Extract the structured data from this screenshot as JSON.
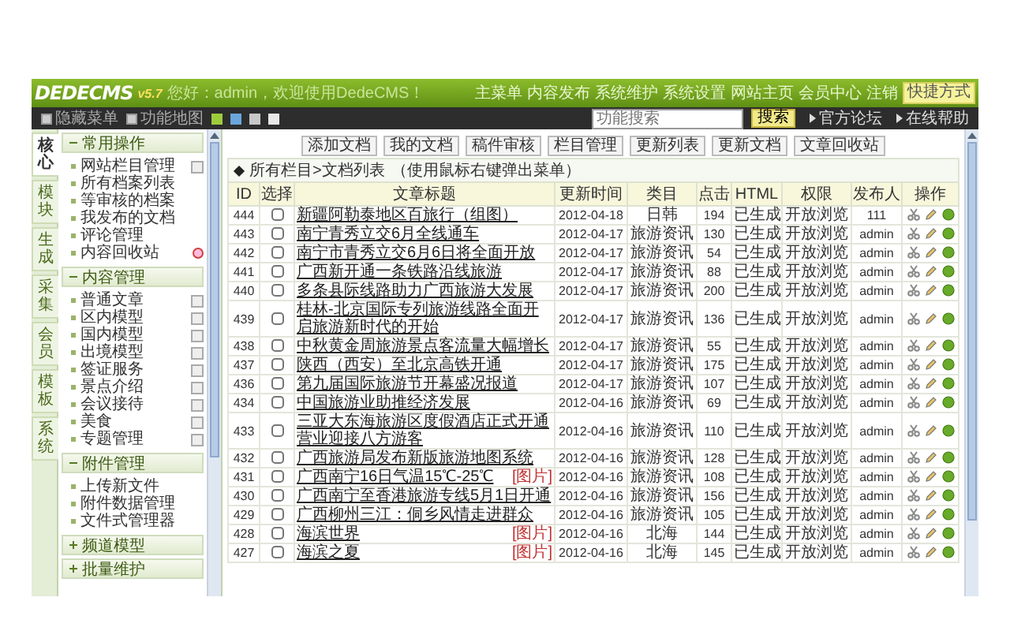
{
  "header": {
    "logo": "DEDECMS",
    "version": "v5.7",
    "welcome": "您好：admin，欢迎使用DedeCMS！",
    "nav": [
      "主菜单",
      "内容发布",
      "系统维护",
      "系统设置",
      "网站主页",
      "会员中心",
      "注销"
    ],
    "shortcut": "快捷方式"
  },
  "toolbar": {
    "buttons": [
      "隐藏菜单",
      "功能地图"
    ],
    "swatches": [
      {
        "color": "#9ccc3c"
      },
      {
        "color": "#6aa6dc"
      },
      {
        "color": "#c8c8c8"
      },
      {
        "color": "#e8e8e8"
      }
    ],
    "search": {
      "placeholder": "功能搜索",
      "button": "搜索"
    },
    "links": [
      "官方论坛",
      "在线帮助"
    ]
  },
  "side_tabs": [
    {
      "label": "核心",
      "selected": true
    },
    {
      "label": "模块",
      "selected": false
    },
    {
      "label": "生成",
      "selected": false
    },
    {
      "label": "采集",
      "selected": false
    },
    {
      "label": "会员",
      "selected": false
    },
    {
      "label": "模板",
      "selected": false
    },
    {
      "label": "系统",
      "selected": false
    }
  ],
  "menu": [
    {
      "title": "常用操作",
      "expanded": true,
      "items": [
        {
          "label": "网站栏目管理",
          "kind": "add"
        },
        {
          "label": "所有档案列表",
          "kind": "plain"
        },
        {
          "label": "等审核的档案",
          "kind": "plain"
        },
        {
          "label": "我发布的文档",
          "kind": "plain"
        },
        {
          "label": "评论管理",
          "kind": "plain"
        },
        {
          "label": "内容回收站",
          "kind": "recycle"
        }
      ]
    },
    {
      "title": "内容管理",
      "expanded": true,
      "items": [
        {
          "label": "普通文章",
          "kind": "add"
        },
        {
          "label": "区内模型",
          "kind": "add"
        },
        {
          "label": "国内模型",
          "kind": "add"
        },
        {
          "label": "出境模型",
          "kind": "add"
        },
        {
          "label": "签证服务",
          "kind": "add"
        },
        {
          "label": "景点介绍",
          "kind": "add"
        },
        {
          "label": "会议接待",
          "kind": "add"
        },
        {
          "label": "美食",
          "kind": "add"
        },
        {
          "label": "专题管理",
          "kind": "add"
        }
      ]
    },
    {
      "title": "附件管理",
      "expanded": true,
      "items": [
        {
          "label": "上传新文件",
          "kind": "plain"
        },
        {
          "label": "附件数据管理",
          "kind": "plain"
        },
        {
          "label": "文件式管理器",
          "kind": "plain"
        }
      ]
    },
    {
      "title": "频道模型",
      "expanded": false
    },
    {
      "title": "批量维护",
      "expanded": false
    }
  ],
  "actions": [
    "添加文档",
    "我的文档",
    "稿件审核",
    "栏目管理",
    "更新列表",
    "更新文档",
    "文章回收站"
  ],
  "list": {
    "title": "所有栏目>文档列表",
    "hint": "（使用鼠标右键弹出菜单）",
    "columns": [
      "ID",
      "选择",
      "文章标题",
      "更新时间",
      "类目",
      "点击",
      "HTML",
      "权限",
      "发布人",
      "操作"
    ],
    "rows": [
      {
        "id": "444",
        "title": "新疆阿勒泰地区百旅行（组图）",
        "tag": "",
        "date": "2012-04-18",
        "category": "日韩",
        "clicks": "194",
        "html": "已生成",
        "access": "开放浏览",
        "author": "111",
        "checked": false
      },
      {
        "id": "443",
        "title": "南宁青秀立交6月全线通车",
        "tag": "",
        "date": "2012-04-17",
        "category": "旅游资讯",
        "clicks": "130",
        "html": "已生成",
        "access": "开放浏览",
        "author": "admin",
        "checked": false
      },
      {
        "id": "442",
        "title": "南宁市青秀立交6月6日将全面开放",
        "tag": "",
        "date": "2012-04-17",
        "category": "旅游资讯",
        "clicks": "54",
        "html": "已生成",
        "access": "开放浏览",
        "author": "admin",
        "checked": false
      },
      {
        "id": "441",
        "title": "广西新开通一条铁路沿线旅游",
        "tag": "",
        "date": "2012-04-17",
        "category": "旅游资讯",
        "clicks": "88",
        "html": "已生成",
        "access": "开放浏览",
        "author": "admin",
        "checked": false
      },
      {
        "id": "440",
        "title": "多条县际线路助力广西旅游大发展",
        "tag": "",
        "date": "2012-04-17",
        "category": "旅游资讯",
        "clicks": "200",
        "html": "已生成",
        "access": "开放浏览",
        "author": "admin",
        "checked": false
      },
      {
        "id": "439",
        "title": "桂林-北京国际专列旅游线路全面开启旅游新时代的开始",
        "tag": "",
        "date": "2012-04-17",
        "category": "旅游资讯",
        "clicks": "136",
        "html": "已生成",
        "access": "开放浏览",
        "author": "admin",
        "checked": false
      },
      {
        "id": "438",
        "title": "中秋黄金周旅游景点客流量大幅增长",
        "tag": "",
        "date": "2012-04-17",
        "category": "旅游资讯",
        "clicks": "55",
        "html": "已生成",
        "access": "开放浏览",
        "author": "admin",
        "checked": false
      },
      {
        "id": "437",
        "title": "陕西（西安）至北京高铁开通",
        "tag": "",
        "date": "2012-04-17",
        "category": "旅游资讯",
        "clicks": "175",
        "html": "已生成",
        "access": "开放浏览",
        "author": "admin",
        "checked": false
      },
      {
        "id": "436",
        "title": "第九届国际旅游节开幕盛况报道",
        "tag": "",
        "date": "2012-04-17",
        "category": "旅游资讯",
        "clicks": "107",
        "html": "已生成",
        "access": "开放浏览",
        "author": "admin",
        "checked": false
      },
      {
        "id": "434",
        "title": "中国旅游业助推经济发展",
        "tag": "",
        "date": "2012-04-16",
        "category": "旅游资讯",
        "clicks": "69",
        "html": "已生成",
        "access": "开放浏览",
        "author": "admin",
        "checked": false
      },
      {
        "id": "433",
        "title": "三亚大东海旅游区度假酒店正式开通营业迎接八方游客",
        "tag": "",
        "date": "2012-04-16",
        "category": "旅游资讯",
        "clicks": "110",
        "html": "已生成",
        "access": "开放浏览",
        "author": "admin",
        "checked": false
      },
      {
        "id": "432",
        "title": "广西旅游局发布新版旅游地图系统",
        "tag": "",
        "date": "2012-04-16",
        "category": "旅游资讯",
        "clicks": "128",
        "html": "已生成",
        "access": "开放浏览",
        "author": "admin",
        "checked": false
      },
      {
        "id": "431",
        "title": "广西南宁16日气温15℃-25℃",
        "tag": "[图片]",
        "date": "2012-04-16",
        "category": "旅游资讯",
        "clicks": "108",
        "html": "已生成",
        "access": "开放浏览",
        "author": "admin",
        "checked": false
      },
      {
        "id": "430",
        "title": "广西南宁至香港旅游专线5月1日开通",
        "tag": "",
        "date": "2012-04-16",
        "category": "旅游资讯",
        "clicks": "156",
        "html": "已生成",
        "access": "开放浏览",
        "author": "admin",
        "checked": false
      },
      {
        "id": "429",
        "title": "广西柳州三江：侗乡风情走进群众",
        "tag": "",
        "date": "2012-04-16",
        "category": "旅游资讯",
        "clicks": "105",
        "html": "已生成",
        "access": "开放浏览",
        "author": "admin",
        "checked": false
      },
      {
        "id": "428",
        "title": "海滨世界",
        "tag": "[图片]",
        "date": "2012-04-16",
        "category": "北海",
        "clicks": "144",
        "html": "已生成",
        "access": "开放浏览",
        "author": "admin",
        "checked": false
      },
      {
        "id": "427",
        "title": "海滨之夏",
        "tag": "[图片]",
        "date": "2012-04-16",
        "category": "北海",
        "clicks": "145",
        "html": "已生成",
        "access": "开放浏览",
        "author": "admin",
        "checked": false
      }
    ]
  }
}
